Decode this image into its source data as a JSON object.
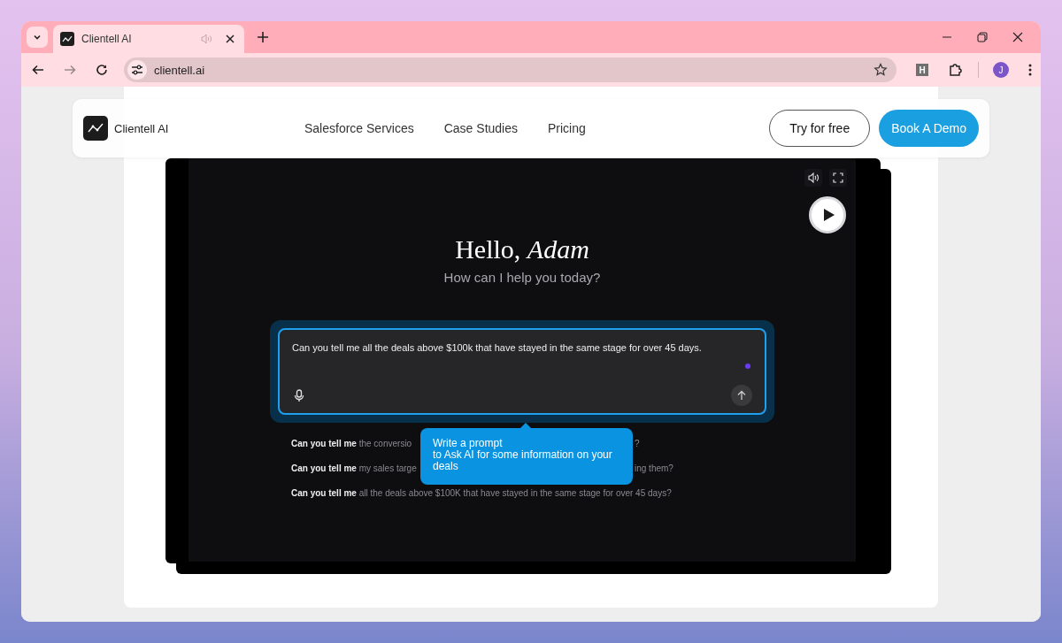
{
  "browser": {
    "tabs": [
      {
        "title": "Clientell AI",
        "selected": true
      }
    ],
    "address": "clientell.ai",
    "extension_label": "H",
    "profile_initial": "J"
  },
  "nav": {
    "brand": "Clientell AI",
    "links": [
      "Salesforce Services",
      "Case Studies",
      "Pricing"
    ],
    "buttons": [
      {
        "label": "Try for free",
        "kind": "outline"
      },
      {
        "label": "Book A Demo",
        "kind": "primary"
      }
    ]
  },
  "video": {
    "greeting": "Hello, *Adam*",
    "subtitle": "How can I help you today?",
    "prompt": {
      "value": "Can you tell me all the deals above $100k that have stayed in the same stage for over 45 days."
    },
    "suggestions": [
      {
        "left": "**Can you tell me** the conversio",
        "right": "?"
      },
      {
        "left": "**Can you tell me** my sales targe",
        "right": "ing them?"
      },
      {
        "left": "**Can you tell me** all the deals above $100K that have stayed in the same stage for over 45 days?"
      }
    ],
    "tooltip": "Write a prompt\nto Ask AI for some information on your deals"
  }
}
